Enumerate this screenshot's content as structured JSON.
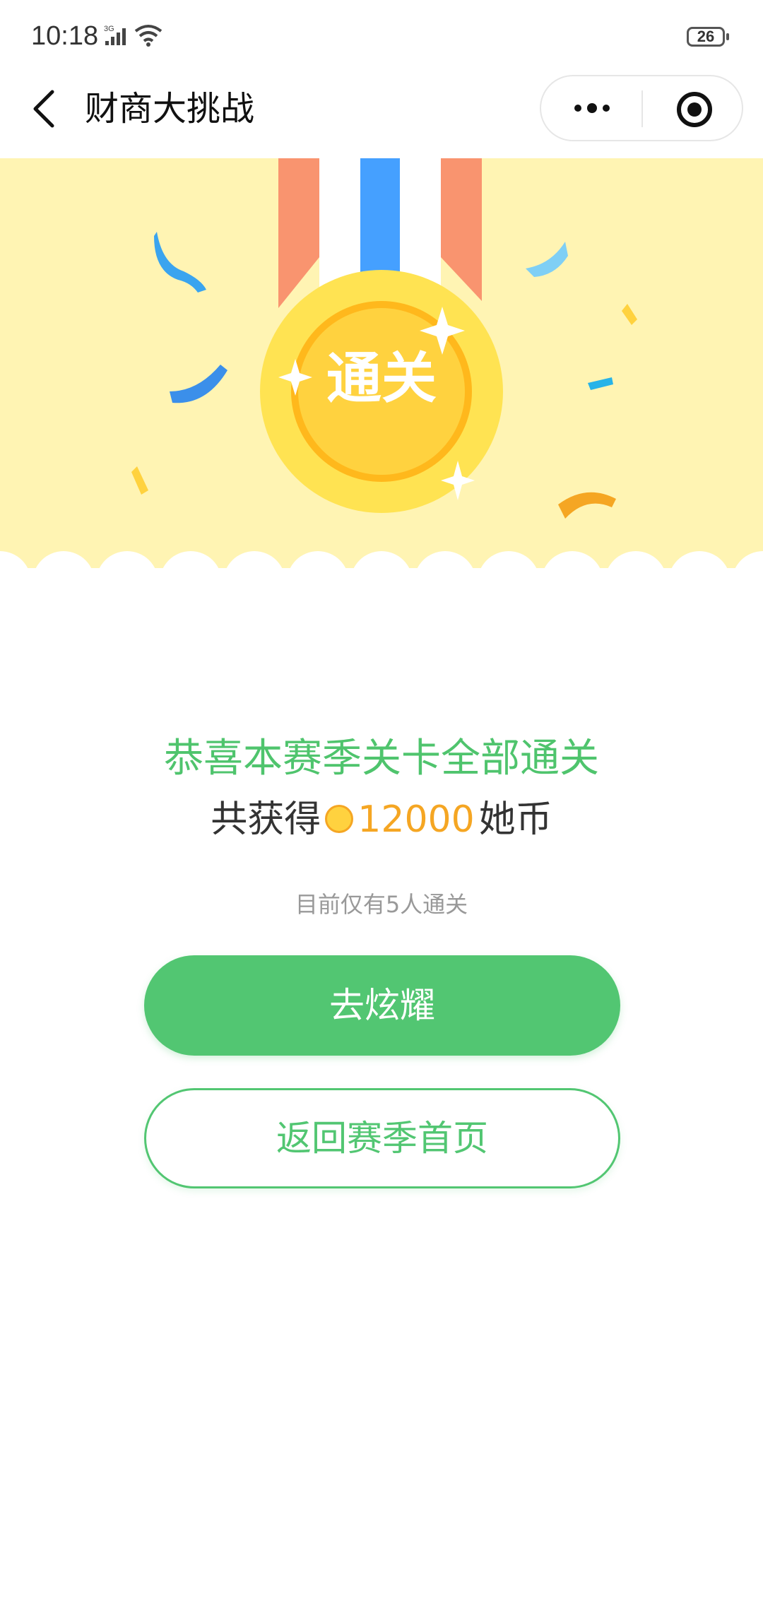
{
  "status_bar": {
    "time": "10:18",
    "network": "3G",
    "battery": "26"
  },
  "nav": {
    "title": "财商大挑战"
  },
  "medal": {
    "label": "通关"
  },
  "result": {
    "congrats": "恭喜本赛季关卡全部通关",
    "reward_prefix": "共获得",
    "reward_amount": "12000",
    "reward_unit": "她币",
    "cleared_note": "目前仅有5人通关"
  },
  "buttons": {
    "show_off": "去炫耀",
    "back_to_season": "返回赛季首页"
  },
  "colors": {
    "accent_green": "#52c672",
    "coin_orange": "#f5a623",
    "banner_bg": "#fff4b3"
  }
}
